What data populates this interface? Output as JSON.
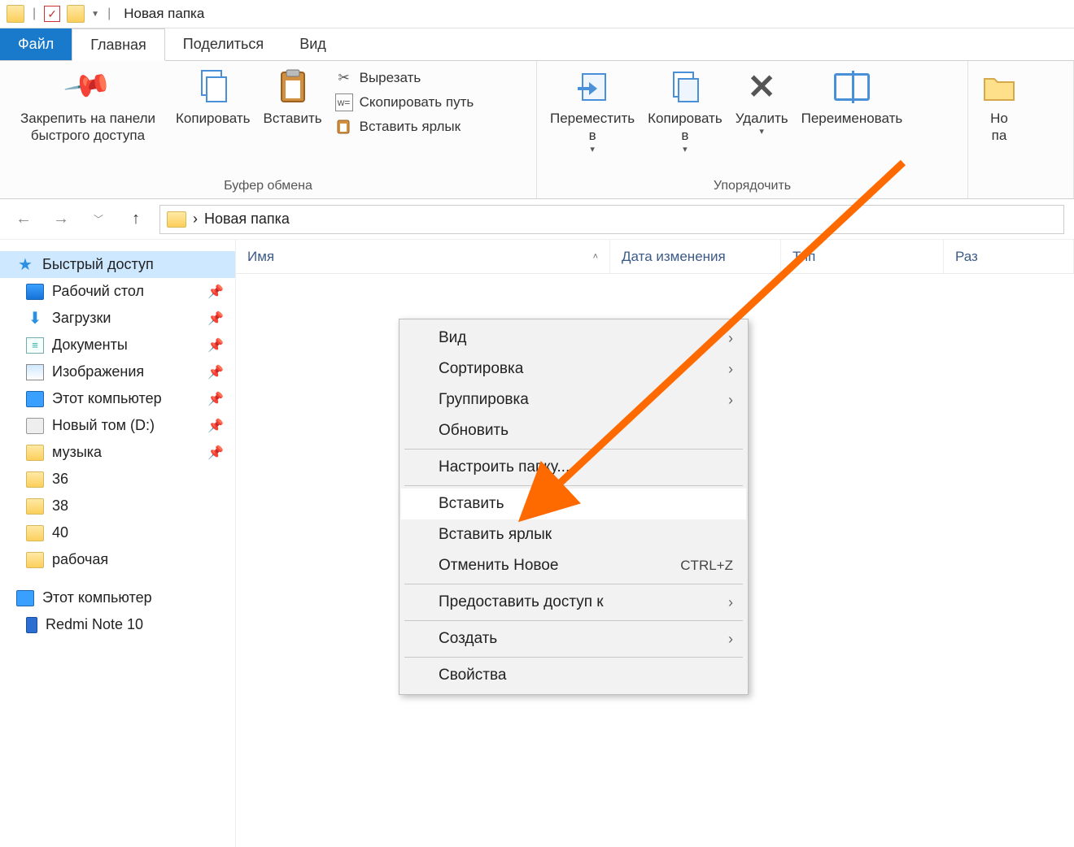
{
  "title": "Новая папка",
  "tabs": {
    "file": "Файл",
    "home": "Главная",
    "share": "Поделиться",
    "view": "Вид"
  },
  "ribbon": {
    "clipboard": {
      "label": "Буфер обмена",
      "pin": "Закрепить на панели\nбыстрого доступа",
      "copy": "Копировать",
      "paste": "Вставить",
      "cut": "Вырезать",
      "copy_path": "Скопировать путь",
      "paste_shortcut": "Вставить ярлык"
    },
    "organize": {
      "label": "Упорядочить",
      "move_to": "Переместить\nв",
      "copy_to": "Копировать\nв",
      "delete": "Удалить",
      "rename": "Переименовать"
    },
    "new": {
      "new_folder": "Но\nпа"
    }
  },
  "breadcrumb": {
    "sep": "›",
    "current": "Новая папка"
  },
  "columns": {
    "name": "Имя",
    "date": "Дата изменения",
    "type": "Тип",
    "size": "Раз"
  },
  "sidebar": {
    "quick_access": "Быстрый доступ",
    "items": [
      {
        "label": "Рабочий стол",
        "icon": "monitor",
        "pinned": true
      },
      {
        "label": "Загрузки",
        "icon": "download",
        "pinned": true
      },
      {
        "label": "Документы",
        "icon": "doc",
        "pinned": true
      },
      {
        "label": "Изображения",
        "icon": "img",
        "pinned": true
      },
      {
        "label": "Этот компьютер",
        "icon": "pc",
        "pinned": true
      },
      {
        "label": "Новый том (D:)",
        "icon": "drive",
        "pinned": true
      },
      {
        "label": "музыка",
        "icon": "folder",
        "pinned": true
      },
      {
        "label": "36",
        "icon": "folder",
        "pinned": false
      },
      {
        "label": "38",
        "icon": "folder",
        "pinned": false
      },
      {
        "label": "40",
        "icon": "folder",
        "pinned": false
      },
      {
        "label": "рабочая",
        "icon": "folder",
        "pinned": false
      }
    ],
    "this_pc": "Этот компьютер",
    "phone": "Redmi Note 10"
  },
  "context_menu": {
    "view": "Вид",
    "sort": "Сортировка",
    "group": "Группировка",
    "refresh": "Обновить",
    "customize": "Настроить папку...",
    "paste": "Вставить",
    "paste_shortcut": "Вставить ярлык",
    "undo": "Отменить Новое",
    "undo_shortcut": "CTRL+Z",
    "share": "Предоставить доступ к",
    "new": "Создать",
    "properties": "Свойства"
  }
}
